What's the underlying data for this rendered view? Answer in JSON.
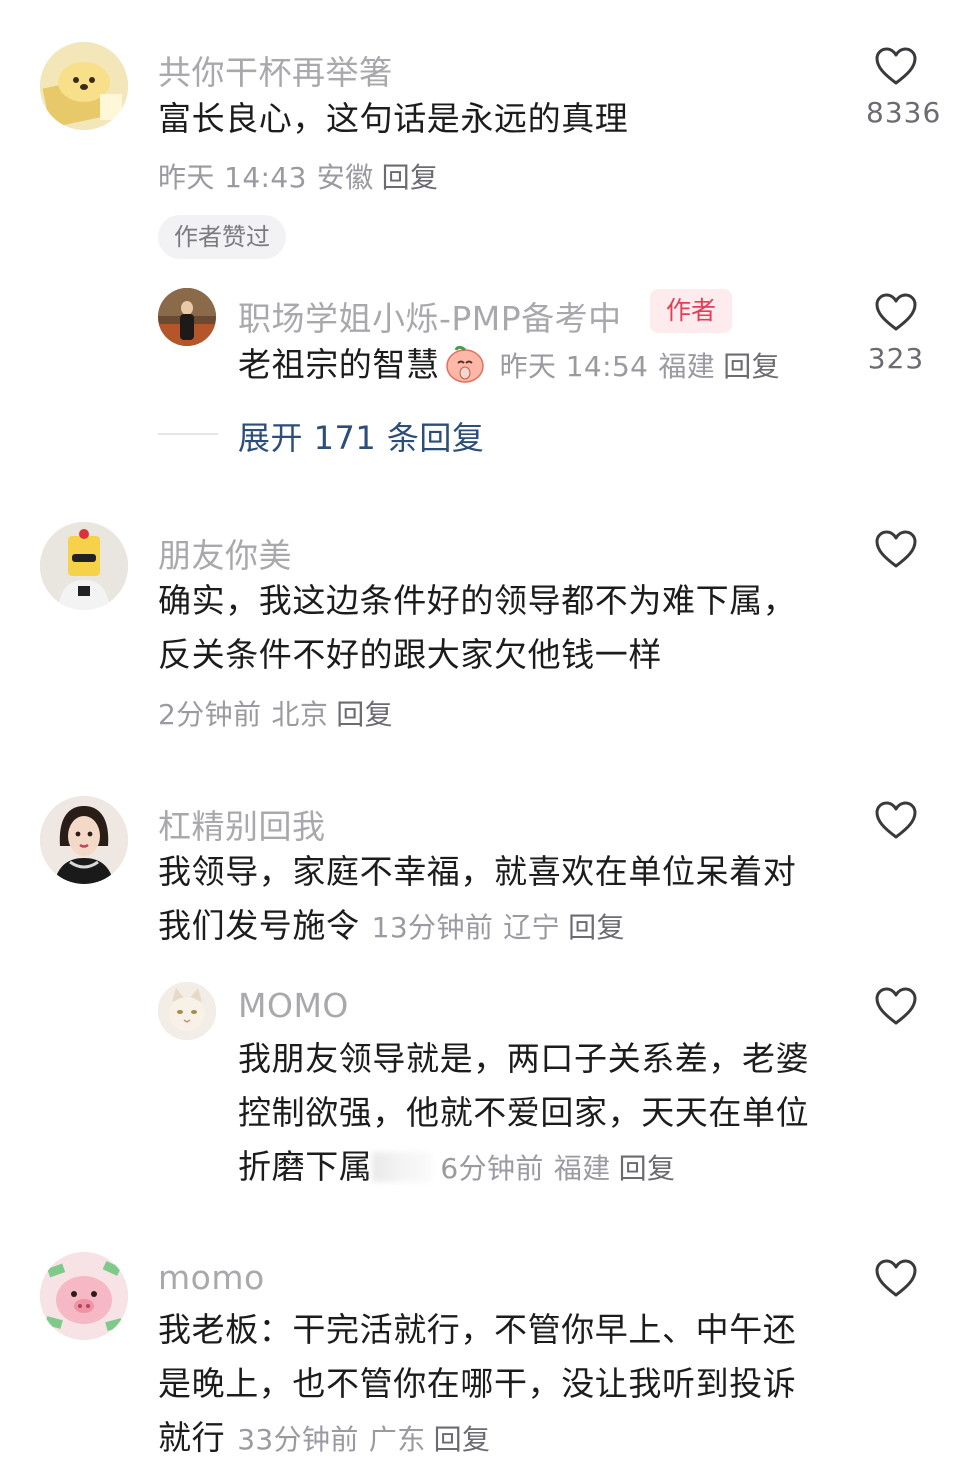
{
  "comments": [
    {
      "username": "共你干杯再举箸",
      "text": [
        "富长良心，这句话是永远的真理"
      ],
      "time": "昨天 14:43",
      "location": "安徽",
      "reply_label": "回复",
      "likes": "8336",
      "badge": "作者赞过",
      "avatar_icon": "yellow-dog-box-avatar",
      "reply": {
        "username": "职场学姐小烁-PMP备考中",
        "author_tag": "作者",
        "text": "老祖宗的智慧",
        "emoji_icon": "praying-peach-emoji-icon",
        "time": "昨天 14:54",
        "location": "福建",
        "reply_label": "回复",
        "likes": "323",
        "avatar_icon": "woman-in-autumn-avatar"
      },
      "expand_label": "展开 171 条回复"
    },
    {
      "username": "朋友你美",
      "text": [
        "确实，我这边条件好的领导都不为难下属，",
        "反关条件不好的跟大家欠他钱一样"
      ],
      "time": "2分钟前",
      "location": "北京",
      "reply_label": "回复",
      "avatar_icon": "cake-head-person-avatar"
    },
    {
      "username": "杠精别回我",
      "text": [
        "我领导，家庭不幸福，就喜欢在单位呆着对",
        "我们发号施令"
      ],
      "time": "13分钟前",
      "location": "辽宁",
      "reply_label": "回复",
      "avatar_icon": "illustrated-woman-avatar",
      "reply": {
        "username": "MOMO",
        "text": [
          "我朋友领导就是，两口子关系差，老婆",
          "控制欲强，他就不爱回家，天天在单位",
          "折磨下属"
        ],
        "time": "6分钟前",
        "location": "福建",
        "reply_label": "回复",
        "avatar_icon": "white-cat-avatar"
      }
    },
    {
      "username": "momo",
      "text": [
        "我老板：干完活就行，不管你早上、中午还",
        "是晚上，也不管你在哪干，没让我听到投诉",
        "就行"
      ],
      "time": "33分钟前",
      "location": "广东",
      "reply_label": "回复",
      "avatar_icon": "pink-pig-money-avatar"
    }
  ],
  "colors": {
    "username": "#a8a8ad",
    "body": "#1c1c1e",
    "meta": "#9a9aa0",
    "link": "#2c4e79",
    "author_tag": "#e63d57",
    "author_tag_bg": "#fdebee"
  }
}
